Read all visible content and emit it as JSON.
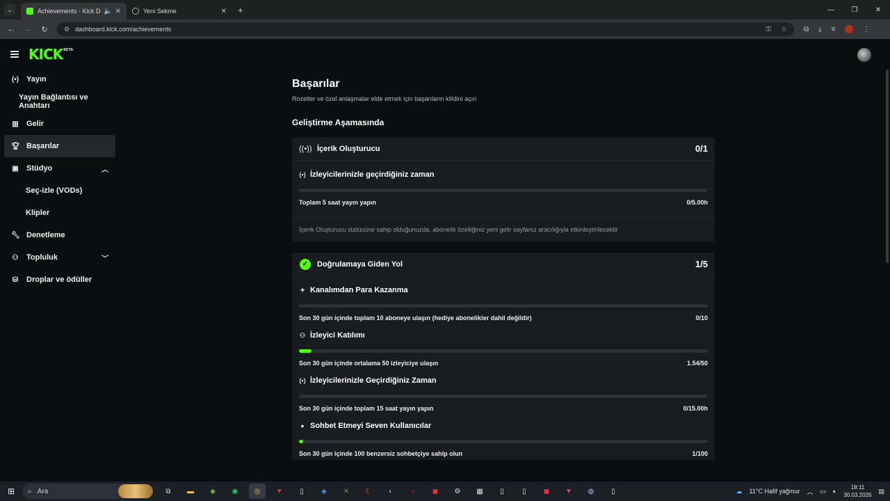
{
  "browser": {
    "tabs": [
      {
        "title": "Achievements - Kick Dashb",
        "active": true
      },
      {
        "title": "Yeni Sekme",
        "active": false
      }
    ],
    "url": "dashboard.kick.com/achievements"
  },
  "brand": {
    "logo": "KICK",
    "beta": "BETA",
    "accent": "#53fc18"
  },
  "sidebar": {
    "items": [
      {
        "label": "Yayın",
        "icon": "broadcast-icon"
      },
      {
        "label": "Yayın Bağlantısı ve Anahtarı"
      },
      {
        "label": "Gelir",
        "icon": "chart-icon"
      },
      {
        "label": "Başarılar",
        "icon": "trophy-icon",
        "active": true
      },
      {
        "label": "Stüdyo",
        "icon": "studio-icon",
        "expanded": true
      },
      {
        "label": "Seç-izle (VODs)"
      },
      {
        "label": "Klipler"
      },
      {
        "label": "Denetleme",
        "icon": "wrench-icon"
      },
      {
        "label": "Topluluk",
        "icon": "community-icon",
        "expanded": false
      },
      {
        "label": "Droplar ve ödüller",
        "icon": "drops-icon"
      }
    ]
  },
  "main": {
    "title": "Başarılar",
    "subtitle": "Rozetler ve özel anlaşmalar elde etmek için başarıların kilidini açın",
    "section": "Geliştirme Aşamasında",
    "cards": [
      {
        "title": "İçerik Oluşturucu",
        "count": "0/1",
        "achievements": [
          {
            "title": "İzleyicilerinizle geçirdiğiniz zaman",
            "desc": "Toplam 5 saat yayın yapın",
            "progress_text": "0/5.00h",
            "progress": 0
          }
        ],
        "note": "İçerik Oluşturucu statüsüne sahip olduğunuzda, abonelik özelliğiniz yeni gelir sayfanız aracılığıyla etkinleştirilecektir"
      },
      {
        "title": "Doğrulamaya Giden Yol",
        "count": "1/5",
        "achievements": [
          {
            "title": "Kanalımdan Para Kazanma",
            "desc": "Son 30 gün içinde toplam 10 aboneye ulaşın (hediye abonelikler dahil değildir)",
            "progress_text": "0/10",
            "progress": 0
          },
          {
            "title": "İzleyici Katılımı",
            "desc": "Son 30 gün içinde ortalama 50 izleyiciye ulaşın",
            "progress_text": "1.54/50",
            "progress": 0.031
          },
          {
            "title": "İzleyicilerinizle Geçirdiğiniz Zaman",
            "desc": "Son 30 gün içinde toplam 15 saat yayın yapın",
            "progress_text": "0/15.00h",
            "progress": 0
          },
          {
            "title": "Sohbet Etmeyi Seven Kullanıcılar",
            "desc": "Son 30 gün içinde 100 benzersiz sohbetçiye sahip olun",
            "progress_text": "1/100",
            "progress": 0.01
          }
        ]
      }
    ]
  },
  "taskbar": {
    "search_placeholder": "Ara",
    "weather": "11°C  Hafif yağmur",
    "time": "18:11",
    "date": "30.03.2026"
  }
}
